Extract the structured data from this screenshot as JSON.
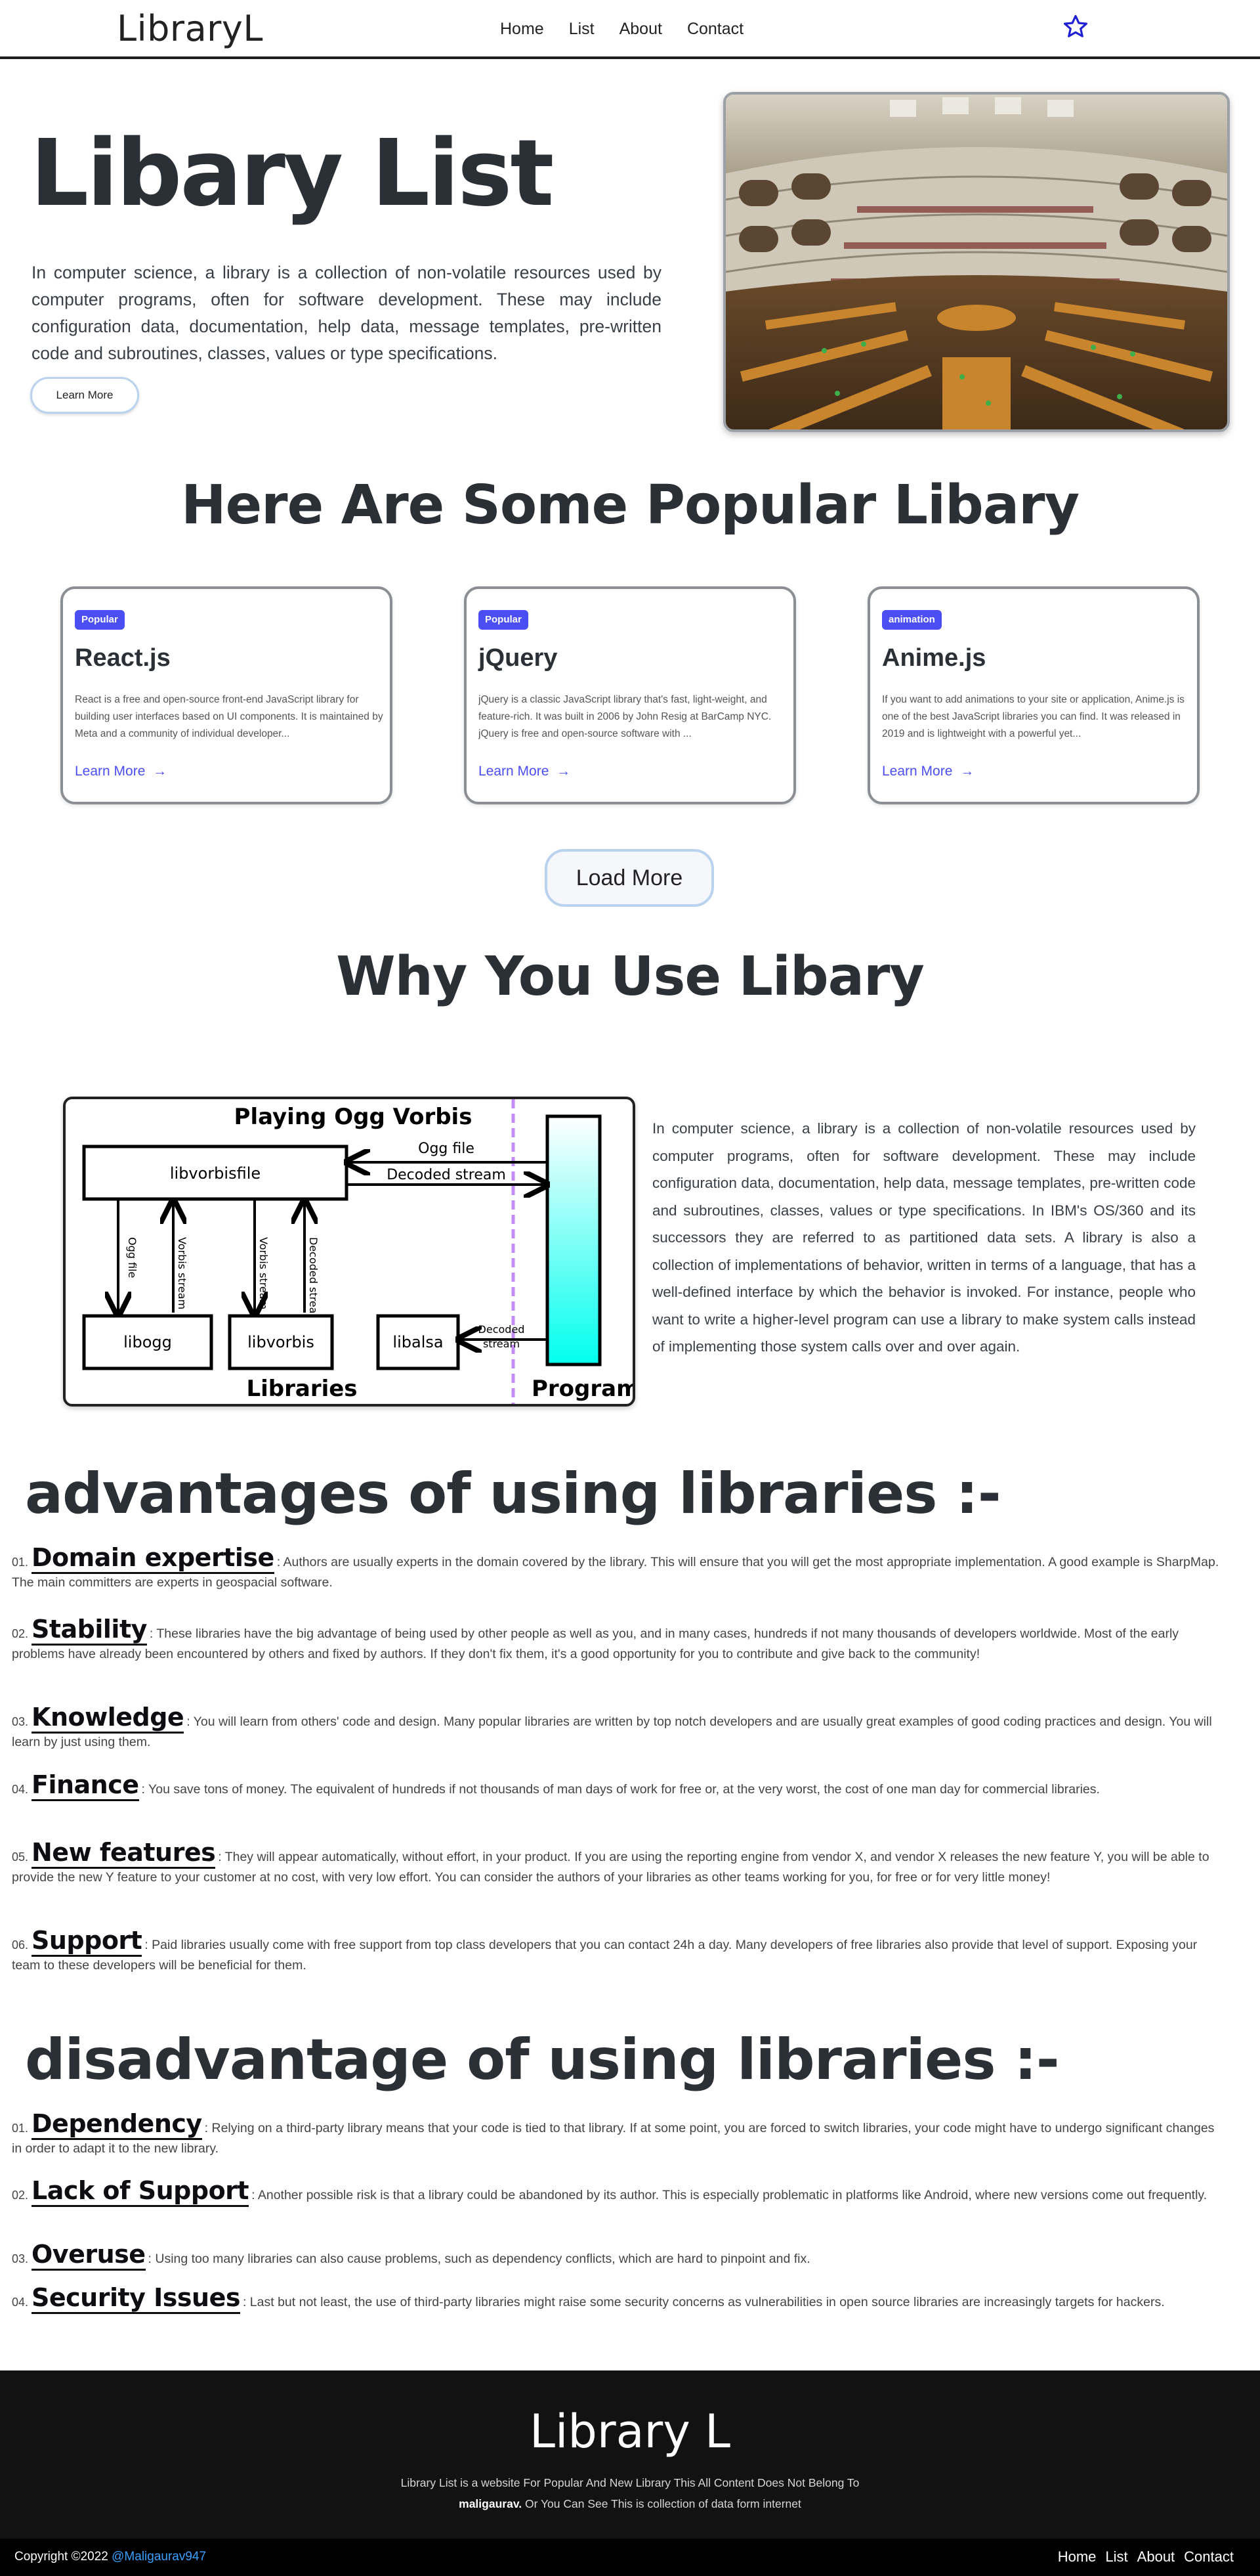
{
  "nav": {
    "brand": "LibraryL",
    "links": [
      "Home",
      "List",
      "About",
      "Contact"
    ],
    "star_color": "#1f1fd6"
  },
  "hero": {
    "title": "Libary List",
    "text": "In computer science, a library is a collection of non-volatile resources used by computer programs, often for software development. These may include configuration data, documentation, help data, message templates, pre-written code and subroutines, classes, values or type specifications.",
    "button": "Learn More"
  },
  "popular": {
    "title": "Here Are Some Popular Libary",
    "cards": [
      {
        "badge": "Popular",
        "title": "React.js",
        "desc": "React is a free and open-source front-end JavaScript library for building user interfaces based on UI components. It is maintained by Meta and a community of individual developer...",
        "link": "Learn More"
      },
      {
        "badge": "Popular",
        "title": "jQuery",
        "desc": "jQuery is a classic JavaScript library that's fast, light-weight, and feature-rich. It was built in 2006 by John Resig at BarCamp NYC. jQuery is free and open-source software with ...",
        "link": "Learn More"
      },
      {
        "badge": "animation",
        "title": "Anime.js",
        "desc": "If you want to add animations to your site or application, Anime.js is one of the best JavaScript libraries you can find. It was released in 2019 and is lightweight with a powerful yet...",
        "link": "Learn More"
      }
    ],
    "load_more": "Load More"
  },
  "why": {
    "title": "Why You Use Libary",
    "text": "In computer science, a library is a collection of non-volatile resources used by computer programs, often for software development. These may include configuration data, documentation, help data, message templates, pre-written code and subroutines, classes, values or type specifications. In IBM's OS/360 and its successors they are referred to as partitioned data sets. A library is also a collection of implementations of behavior, written in terms of a language, that has a well-defined interface by which the behavior is invoked. For instance, people who want to write a higher-level program can use a library to make system calls instead of implementing those system calls over and over again.",
    "diagram": {
      "title": "Playing Ogg Vorbis",
      "box_main": "libvorbisfile",
      "box_ogg": "libogg",
      "box_vorbis": "libvorbis",
      "box_alsa": "libalsa",
      "arrow_ogg_file": "Ogg file",
      "arrow_decoded": "Decoded stream",
      "v_ogg_file": "Ogg file",
      "v_vorbis_stream": "Vorbis stream",
      "v_vorbis_stream2": "Vorbis stream",
      "v_decoded_stream": "Decoded stream",
      "alsa_decoded_1": "Decoded",
      "alsa_decoded_2": "stream",
      "libraries": "Libraries",
      "program": "Program"
    }
  },
  "advantages": {
    "heading": "advantages of using libraries :-",
    "items": [
      {
        "num": "01.",
        "term": "Domain expertise",
        "desc": ": Authors are usually experts in the domain covered by the library. This will ensure that you will get the most appropriate implementation. A good example is SharpMap. The main committers are experts in geospacial software."
      },
      {
        "num": "02.",
        "term": "Stability",
        "desc": ": These libraries have the big advantage of being used by other people as well as you, and in many cases, hundreds if not many thousands of developers worldwide. Most of the early problems have already been encountered by others and fixed by authors. If they don't fix them, it's a good opportunity for you to contribute and give back to the community!"
      },
      {
        "num": "03.",
        "term": "Knowledge",
        "desc": ": You will learn from others' code and design. Many popular libraries are written by top notch developers and are usually great examples of good coding practices and design. You will learn by just using them."
      },
      {
        "num": "04.",
        "term": "Finance",
        "desc": ": You save tons of money. The equivalent of hundreds if not thousands of man days of work for free or, at the very worst, the cost of one man day for commercial libraries."
      },
      {
        "num": "05.",
        "term": "New features",
        "desc": ": They will appear automatically, without effort, in your product. If you are using the reporting engine from vendor X, and vendor X releases the new feature Y, you will be able to provide the new Y feature to your customer at no cost, with very low effort. You can consider the authors of your libraries as other teams working for you, for free or for very little money!"
      },
      {
        "num": "06.",
        "term": "Support",
        "desc": ": Paid libraries usually come with free support from top class developers that you can contact 24h a day. Many developers of free libraries also provide that level of support. Exposing your team to these developers will be beneficial for them."
      }
    ]
  },
  "disadvantages": {
    "heading": "disadvantage of using libraries :-",
    "items": [
      {
        "num": "01.",
        "term": "Dependency",
        "desc": ": Relying on a third-party library means that your code is tied to that library. If at some point, you are forced to switch libraries, your code might have to undergo significant changes in order to adapt it to the new library."
      },
      {
        "num": "02.",
        "term": "Lack of Support",
        "desc": ": Another possible risk is that a library could be abandoned by its author. This is especially problematic in platforms like Android, where new versions come out frequently."
      },
      {
        "num": "03.",
        "term": "Overuse",
        "desc": ": Using too many libraries can also cause problems, such as dependency conflicts, which are hard to pinpoint and fix."
      },
      {
        "num": "04.",
        "term": "Security Issues",
        "desc": ": Last but not least, the use of third-party libraries might raise some security concerns as vulnerabilities in open source libraries are increasingly targets for hackers."
      }
    ]
  },
  "footer": {
    "title": "Library L",
    "desc_line1": "Library List is a website For Popular And New Library This All Content Does Not Belong To",
    "desc_name": "maligaurav.",
    "desc_line2": " Or You Can See This is collection of data form internet",
    "copyright": "Copyright ©2022 ",
    "handle": "@Maligaurav947",
    "links": [
      "Home",
      "List",
      "About",
      "Contact"
    ]
  }
}
